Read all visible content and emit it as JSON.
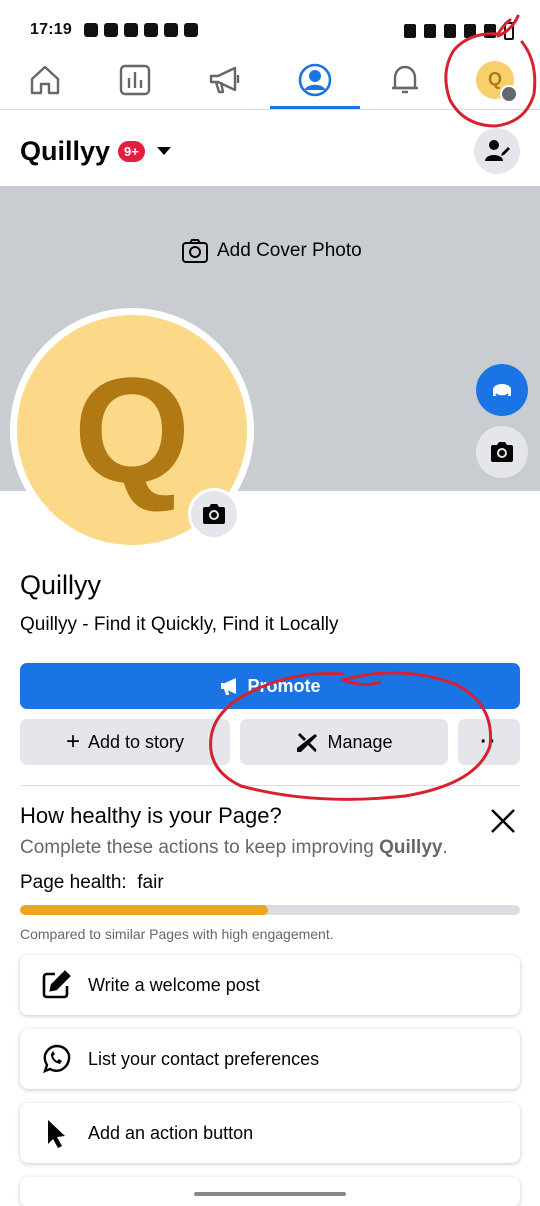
{
  "status_bar": {
    "time": "17:19"
  },
  "nav": {
    "tabs": [
      {
        "name": "home",
        "icon": "home-icon"
      },
      {
        "name": "insights",
        "icon": "chart-icon"
      },
      {
        "name": "ads",
        "icon": "megaphone-icon"
      },
      {
        "name": "profile",
        "icon": "profile-icon",
        "active": true
      },
      {
        "name": "notifications",
        "icon": "bell-icon"
      },
      {
        "name": "menu",
        "icon": "page-avatar-icon"
      }
    ],
    "avatar_letter": "Q"
  },
  "page": {
    "name": "Quillyy",
    "notification_badge": "9+",
    "tagline": "Quillyy - Find it Quickly, Find it Locally",
    "avatar_letter": "Q"
  },
  "cover": {
    "add_label": "Add Cover Photo"
  },
  "actions": {
    "promote_label": "Promote",
    "add_story_label": "Add to story",
    "manage_label": "Manage",
    "more_label": "··"
  },
  "health": {
    "title": "How healthy is your Page?",
    "desc_prefix": "Complete these actions to keep improving ",
    "desc_page": "Quillyy",
    "desc_suffix": ".",
    "label_prefix": "Page health:",
    "label_value": "fair",
    "progress": 0.495,
    "note": "Compared to similar Pages with high engagement."
  },
  "tasks": [
    {
      "label": "Write a welcome post",
      "icon": "edit-icon"
    },
    {
      "label": "List your contact preferences",
      "icon": "whatsapp-icon"
    },
    {
      "label": "Add an action button",
      "icon": "cursor-icon"
    }
  ],
  "colors": {
    "accent": "#1b74e4",
    "health_fill": "#e9a81c",
    "annotation": "#d8212e",
    "avatar_bg": "#fbd989"
  }
}
